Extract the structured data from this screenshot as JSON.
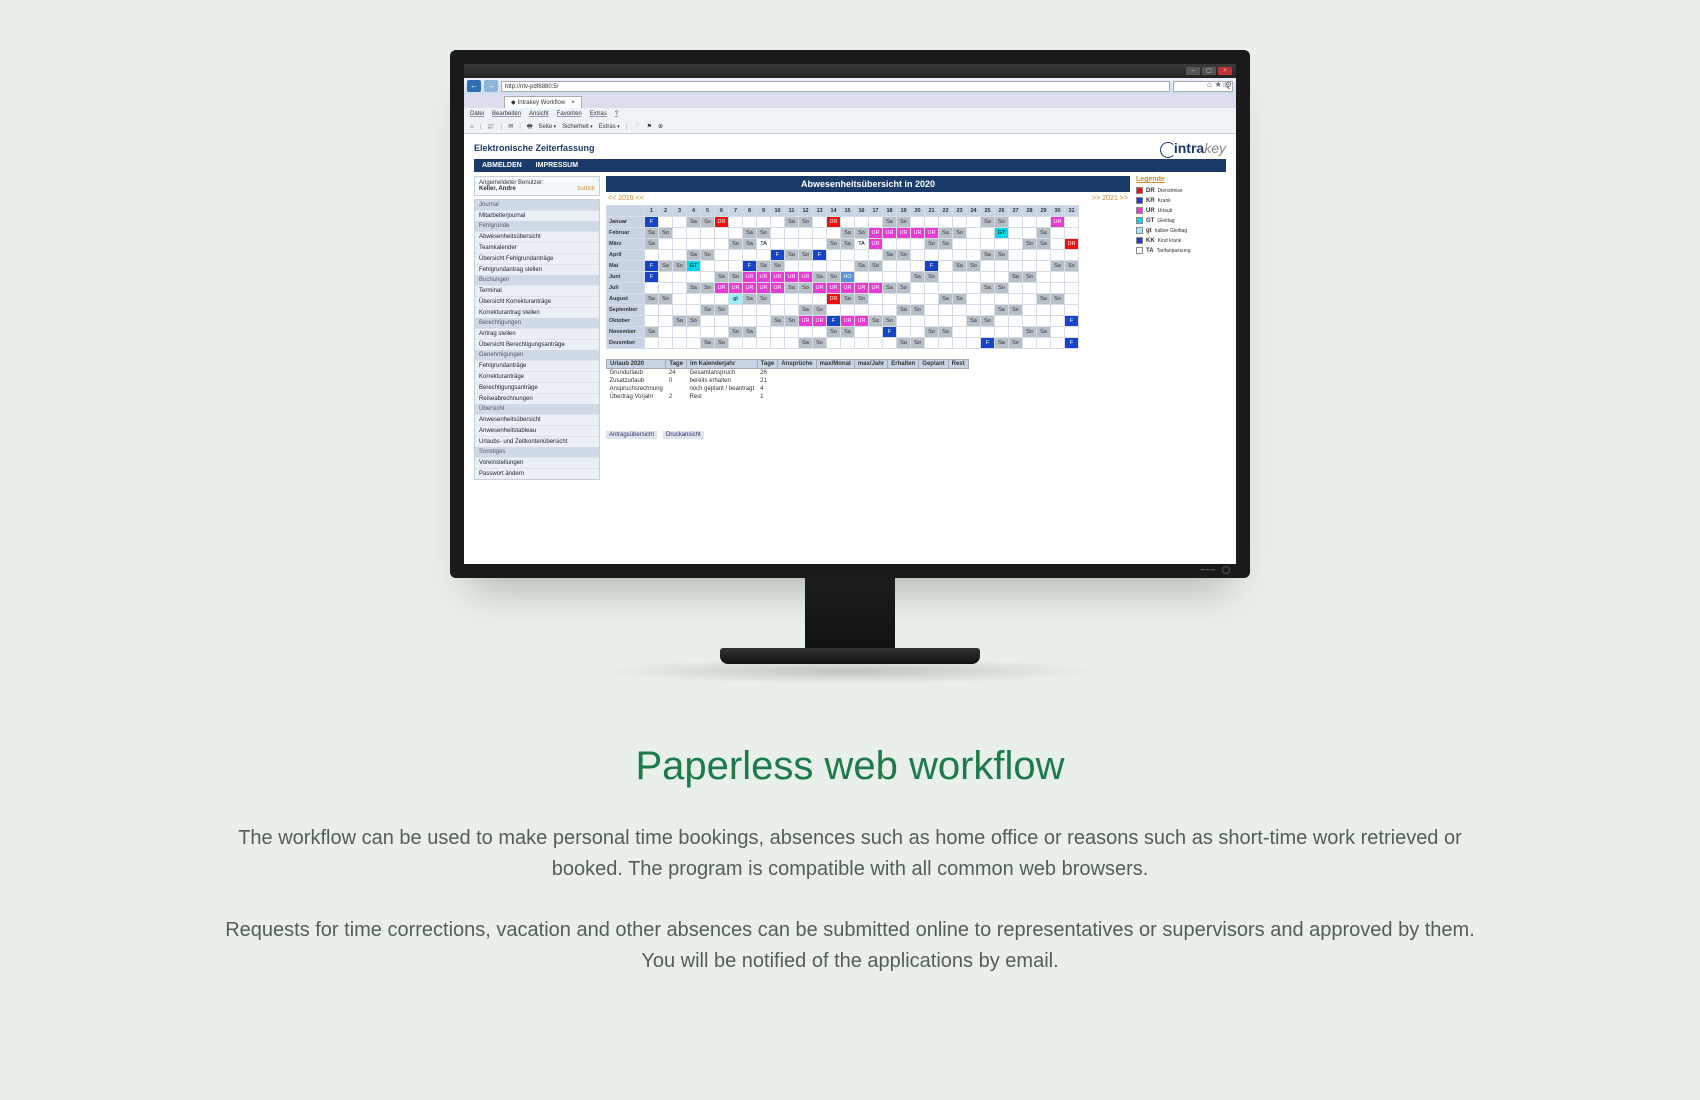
{
  "browser": {
    "url": "http://ntv-pdf6880:5/",
    "tab_title": "Intrakey Workflow",
    "menus": [
      "Datei",
      "Bearbeiten",
      "Ansicht",
      "Favoriten",
      "Extras",
      "?"
    ],
    "toolbar": [
      "⌂",
      "📰",
      "✉",
      "🖶",
      "Seite",
      "Sicherheit",
      "Extras",
      "❔",
      "⚑",
      "⊕"
    ]
  },
  "page": {
    "title": "Elektronische Zeiterfassung",
    "logo_main": "intra",
    "logo_sub": "key",
    "nav": [
      "ABMELDEN",
      "IMPRESSUM"
    ]
  },
  "sidebar": {
    "user_label": "Angemeldeter Benutzer:",
    "user_name": "Keller, Andre",
    "back": "zurück",
    "sections": [
      {
        "hdr": "Journal",
        "items": [
          "Mitarbeiterjournal"
        ]
      },
      {
        "hdr": "Fehlgründe",
        "items": [
          "Abwesenheitsübersicht",
          "Teamkalender",
          "Übersicht Fehlgrundanträge",
          "Fehlgrundantrag stellen"
        ]
      },
      {
        "hdr": "Buchungen",
        "items": [
          "Terminal",
          "Übersicht Korrekturanträge",
          "Korrekturantrag stellen"
        ]
      },
      {
        "hdr": "Berechtigungen",
        "items": [
          "Antrag stellen",
          "Übersicht Berechtigungsanträge"
        ]
      },
      {
        "hdr": "Genehmigungen",
        "items": [
          "Fehlgrundanträge",
          "Korrekturanträge",
          "Berechtigungsanträge",
          "Reiseabrechnungen"
        ]
      },
      {
        "hdr": "Übersicht",
        "items": [
          "Anwesenheitsübersicht",
          "Anwesenheitstableau",
          "Urlaubs- und Zeitkontenübersicht"
        ]
      },
      {
        "hdr": "Sonstiges",
        "items": [
          "Voreinstellungen",
          "Passwort ändern"
        ]
      }
    ]
  },
  "calendar": {
    "title": "Abwesenheitsübersicht in 2020",
    "prev": "<< 2019 <<",
    "next": ">> 2021 >>",
    "days": [
      "1",
      "2",
      "3",
      "4",
      "5",
      "6",
      "7",
      "8",
      "9",
      "10",
      "11",
      "12",
      "13",
      "14",
      "15",
      "16",
      "17",
      "18",
      "19",
      "20",
      "21",
      "22",
      "23",
      "24",
      "25",
      "26",
      "27",
      "28",
      "29",
      "30",
      "31"
    ],
    "months": [
      "Januar",
      "Februar",
      "März",
      "April",
      "Mai",
      "Juni",
      "Juli",
      "August",
      "September",
      "Oktober",
      "November",
      "Dezember"
    ],
    "legend_title": "Legende",
    "legend": [
      {
        "k": "DR",
        "t": "Dienstreise",
        "c": "#e11"
      },
      {
        "k": "KR",
        "t": "Krank",
        "c": "#1744c9"
      },
      {
        "k": "UR",
        "t": "Urlaub",
        "c": "#e83bd4"
      },
      {
        "k": "GT",
        "t": "Gleittag",
        "c": "#00d8e8"
      },
      {
        "k": "gt",
        "t": "halber Gleittag",
        "c": "#a0eef5"
      },
      {
        "k": "KK",
        "t": "Kind krank",
        "c": "#1744c9"
      },
      {
        "k": "TA",
        "t": "Tarifanpassung",
        "c": "#fff"
      }
    ],
    "grid": [
      [
        "F",
        "",
        "",
        "we",
        "we",
        "DR",
        "",
        "",
        "",
        "",
        "we",
        "we",
        "",
        "DR",
        "",
        "",
        "",
        "we",
        "we",
        "",
        "",
        "",
        "",
        "",
        "we",
        "we",
        "",
        "",
        "",
        "UR",
        ""
      ],
      [
        "we",
        "we",
        "",
        "",
        "",
        "",
        "",
        "we",
        "we",
        "",
        "",
        "",
        "",
        "",
        "we",
        "we",
        "UR",
        "UR",
        "UR",
        "UR",
        "UR",
        "we",
        "we",
        "",
        "",
        "GT",
        "",
        "",
        "we",
        "",
        ""
      ],
      [
        "we",
        "",
        "",
        "",
        "",
        "",
        "we",
        "we",
        "TA",
        "",
        "",
        "",
        "",
        "we",
        "we",
        "TA",
        "UR",
        "",
        "",
        "",
        "we",
        "we",
        "",
        "",
        "",
        "",
        "",
        "we",
        "we",
        "",
        "DR"
      ],
      [
        "",
        "",
        "",
        "we",
        "we",
        "",
        "",
        "",
        "",
        "F",
        "we",
        "we",
        "F",
        "",
        "",
        "",
        "",
        "we",
        "we",
        "",
        "",
        "",
        "",
        "",
        "we",
        "we",
        "",
        "",
        "",
        "",
        ""
      ],
      [
        "F",
        "we",
        "we",
        "GT",
        "",
        "",
        "",
        "F",
        "we",
        "we",
        "",
        "",
        "",
        "",
        "",
        "we",
        "we",
        "",
        "",
        "",
        "F",
        "",
        "we",
        "we",
        "",
        "",
        "",
        "",
        "",
        "we",
        "we"
      ],
      [
        "F",
        "",
        "",
        "",
        "",
        "we",
        "we",
        "UR",
        "UR",
        "UR",
        "UR",
        "UR",
        "we",
        "we",
        "HO",
        "",
        "",
        "",
        "",
        "we",
        "we",
        "",
        "",
        "",
        "",
        "",
        "we",
        "we",
        "",
        "",
        ""
      ],
      [
        "",
        "",
        "",
        "we",
        "we",
        "UR",
        "UR",
        "UR",
        "UR",
        "UR",
        "we",
        "we",
        "UR",
        "UR",
        "UR",
        "UR",
        "UR",
        "we",
        "we",
        "",
        "",
        "",
        "",
        "",
        "we",
        "we",
        "",
        "",
        "",
        "",
        ""
      ],
      [
        "we",
        "we",
        "",
        "",
        "",
        "",
        "gt",
        "we",
        "we",
        "",
        "",
        "",
        "",
        "DR",
        "we",
        "we",
        "",
        "",
        "",
        "",
        "",
        "we",
        "we",
        "",
        "",
        "",
        "",
        "",
        "we",
        "we",
        ""
      ],
      [
        "",
        "",
        "",
        "",
        "we",
        "we",
        "",
        "",
        "",
        "",
        "",
        "we",
        "we",
        "",
        "",
        "",
        "",
        "",
        "we",
        "we",
        "",
        "",
        "",
        "",
        "",
        "we",
        "we",
        "",
        "",
        "",
        ""
      ],
      [
        "",
        "",
        "we",
        "we",
        "",
        "",
        "",
        "",
        "",
        "we",
        "we",
        "UR",
        "UR",
        "F",
        "UR",
        "UR",
        "we",
        "we",
        "",
        "",
        "",
        "",
        "",
        "we",
        "we",
        "",
        "",
        "",
        "",
        "",
        "F"
      ],
      [
        "we",
        "",
        "",
        "",
        "",
        "",
        "we",
        "we",
        "",
        "",
        "",
        "",
        "",
        "we",
        "we",
        "",
        "",
        "F",
        "",
        "",
        "we",
        "we",
        "",
        "",
        "",
        "",
        "",
        "we",
        "we",
        "",
        ""
      ],
      [
        "",
        "",
        "",
        "",
        "we",
        "we",
        "",
        "",
        "",
        "",
        "",
        "we",
        "we",
        "",
        "",
        "",
        "",
        "",
        "we",
        "we",
        "",
        "",
        "",
        "",
        "F",
        "we",
        "we",
        "",
        "",
        "",
        "F"
      ]
    ]
  },
  "summary": {
    "headers1": [
      "Urlaub 2020",
      "Tage"
    ],
    "headers2": [
      "im Kalenderjahr",
      "Tage",
      "Ansprüche",
      "max/Monat",
      "max/Jahr",
      "Erhalten",
      "Geplant",
      "Rest"
    ],
    "rows": [
      [
        "Grundurlaub",
        "24",
        "Gesamtanspruch",
        "26"
      ],
      [
        "Zusatzurlaub",
        "0",
        "bereits erhalten",
        "21"
      ],
      [
        "Anspruchsrechnung",
        "",
        "noch geplant / beantragt",
        "4"
      ],
      [
        "Übertrag Vorjahr",
        "2",
        "Rest",
        "1"
      ]
    ]
  },
  "bottom_links": [
    "Antragsübersicht",
    "Druckansicht"
  ],
  "marketing": {
    "headline": "Paperless web workflow",
    "p1": "The workflow can be used to make personal time bookings, absences such as home office or reasons such as short-time work retrieved or booked. The program is compatible with all common web browsers.",
    "p2": "Requests for time corrections, vacation and other absences can be submitted online to representatives or supervisors and approved by them. You will be notified of the applications by email."
  }
}
